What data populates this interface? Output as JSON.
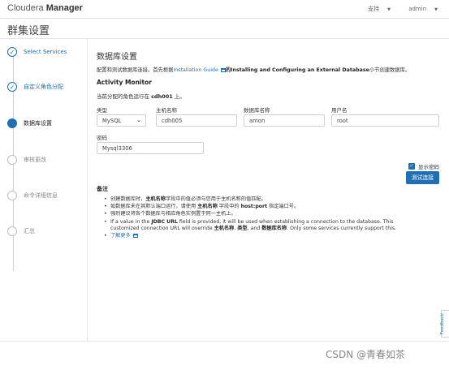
{
  "header": {
    "brand_prefix": "Cloudera",
    "brand_name": "Manager",
    "support_label": "支持",
    "user_label": "admin"
  },
  "page_title": "群集设置",
  "steps": [
    {
      "label": "Select Services",
      "state": "done"
    },
    {
      "label": "自定义角色分配",
      "state": "done"
    },
    {
      "label": "数据库设置",
      "state": "active"
    },
    {
      "label": "审核更改",
      "state": "pending"
    },
    {
      "label": "命令详细信息",
      "state": "pending"
    },
    {
      "label": "汇总",
      "state": "pending"
    }
  ],
  "main": {
    "title": "数据库设置",
    "intro_prefix": "配置和测试数据库连接。首先根据",
    "intro_link": "Installation Guide",
    "intro_bold": "的Installing and Configuring an External Database",
    "intro_suffix": "小节创建数据库。",
    "section_title": "Activity Monitor",
    "host_prefix": "当前分配的角色运行在",
    "host_name": "cdh001",
    "host_suffix": "上。",
    "labels": {
      "type": "类型",
      "hostname": "主机名称",
      "dbname": "数据库名称",
      "username": "用户名",
      "password": "密码"
    },
    "values": {
      "type": "MySQL",
      "hostname": "cdh005",
      "dbname": "amon",
      "username": "root",
      "password": "Mysql3306"
    },
    "show_password_label": "显示密码",
    "test_button": "测试连接",
    "notes_title": "备注",
    "notes": {
      "n1_a": "创建数据库时，",
      "n1_b": "主机名称",
      "n1_c": "字段中的值必须与您用于主机名称的值匹配。",
      "n2_a": "如数据库未在其默认端口运行，请使用",
      "n2_b": "主机名称",
      "n2_c": "字段中的",
      "n2_d": "host:port",
      "n2_e": "指定端口号。",
      "n3": "强烈建议将各个数据库与相应角色实例置于同一主机上。",
      "n4_a": "If a value in the",
      "n4_b": "JDBC URL",
      "n4_c": "field is provided, it will be used when establishing a connection to the database. This customized connection URL will override",
      "n4_d": "主机名称",
      "n4_e": ",",
      "n4_f": "类型",
      "n4_g": ", and",
      "n4_h": "数据库名称",
      "n4_i": ". Only some services currently support this.",
      "learn_more": "了解更多"
    }
  },
  "feedback_label": "Feedback",
  "watermark": "CSDN @青春如茶",
  "colors": {
    "accent": "#1f6fb5"
  }
}
